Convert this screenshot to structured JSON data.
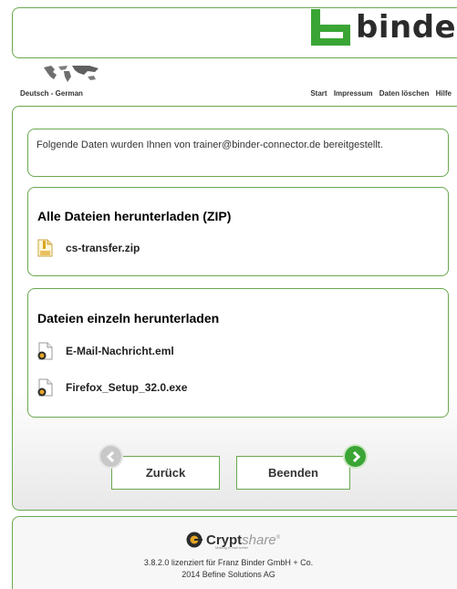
{
  "brand": {
    "name": "binder",
    "color": "#3aa535"
  },
  "lang": {
    "icon": "world-map-icon",
    "label": "Deutsch - German"
  },
  "topnav": [
    "Start",
    "Impressum",
    "Daten löschen",
    "Hilfe"
  ],
  "info": {
    "text": "Folgende Daten wurden Ihnen von trainer@binder-connector.de bereitgestellt."
  },
  "zip_section": {
    "title": "Alle Dateien herunterladen (ZIP)",
    "file": {
      "name": "cs-transfer.zip",
      "icon": "zip-file-icon"
    }
  },
  "single_section": {
    "title": "Dateien einzeln herunterladen",
    "files": [
      {
        "name": "E-Mail-Nachricht.eml",
        "icon": "document-icon"
      },
      {
        "name": "Firefox_Setup_32.0.exe",
        "icon": "document-icon"
      }
    ]
  },
  "buttons": {
    "back": "Zurück",
    "end": "Beenden"
  },
  "footer": {
    "logo_main": "Crypt",
    "logo_italic": "share",
    "logo_tm": "®",
    "tagline": "Making e-mail better",
    "line1": "3.8.2.0 lizenziert für Franz Binder GmbH + Co.",
    "line2": "2014 Befine Solutions AG"
  },
  "colors": {
    "border": "#6aa84f",
    "accent": "#3aa535"
  }
}
